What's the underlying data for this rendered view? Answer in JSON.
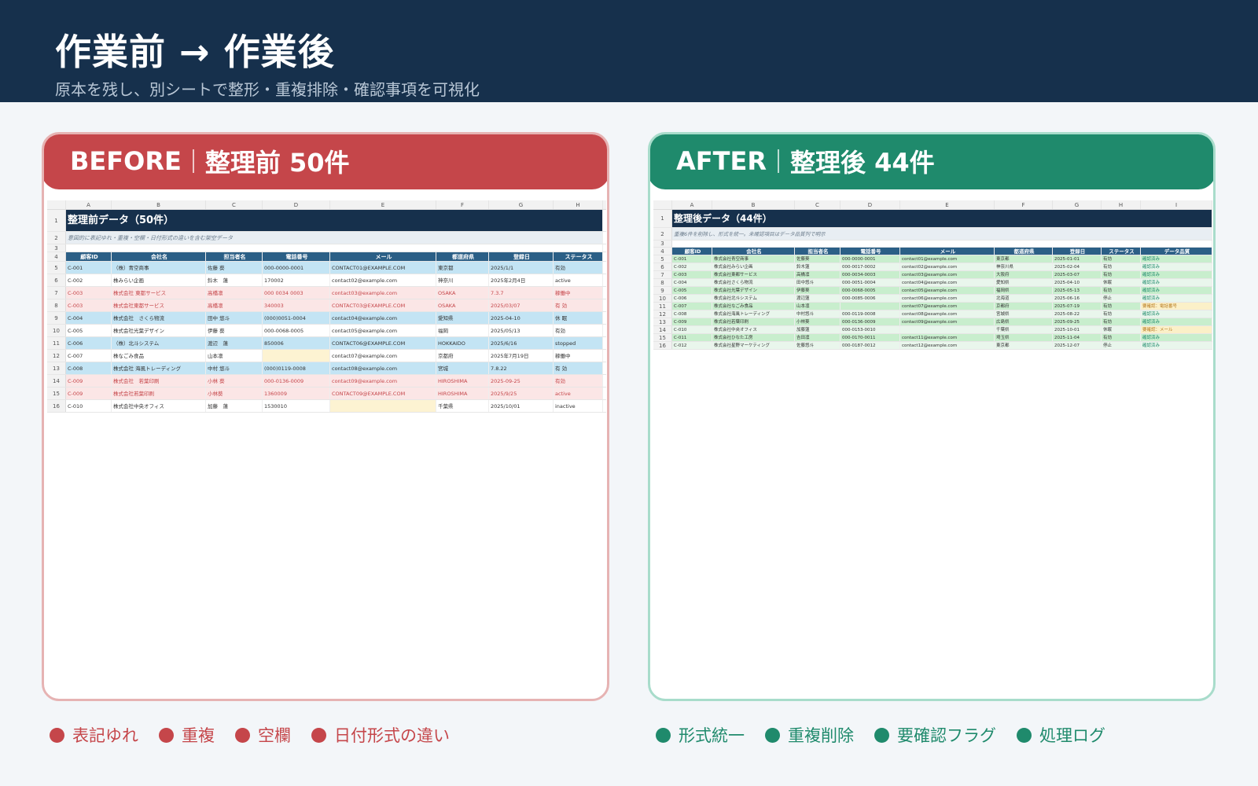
{
  "header": {
    "title": "作業前 → 作業後",
    "subtitle": "原本を残し、別シートで整形・重複排除・確認事項を可視化"
  },
  "before": {
    "label": "BEFORE",
    "count_label": "整理前 50件",
    "sheet": {
      "columns": [
        "A",
        "B",
        "C",
        "D",
        "E",
        "F",
        "G",
        "H"
      ],
      "title": "整理前データ（50件）",
      "note": "意図的に表記ゆれ・重複・空欄・日付形式の違いを含む架空データ",
      "headers": [
        "顧客ID",
        "会社名",
        "担当者名",
        "電話番号",
        "メール",
        "都道府県",
        "登録日",
        "ステータス"
      ],
      "rows": [
        {
          "n": "5",
          "style": "blue",
          "cells": [
            "C-001",
            "（株）青空商事",
            "佐藤 葵",
            "000-0000-0001",
            "CONTACT01@EXAMPLE.COM",
            "東京都",
            "2025/1/1",
            "有効"
          ]
        },
        {
          "n": "6",
          "style": "white",
          "cells": [
            "C-002",
            "株みらい企画",
            "鈴木　蓮",
            "170002",
            "contact02@example.com",
            "神奈川",
            "2025年2月4日",
            "active"
          ]
        },
        {
          "n": "7",
          "style": "pink",
          "cells": [
            "C-003",
            "株式会社 東都サービス",
            "高橋凛",
            "000 0034 0003",
            "contact03@example.com",
            "OSAKA",
            "7.3.7",
            "稼働中"
          ]
        },
        {
          "n": "8",
          "style": "pink",
          "cells": [
            "C-003",
            "株式会社東都サービス",
            "高橋凛",
            "340003",
            "CONTACT03@EXAMPLE.COM",
            "OSAKA",
            "2025/03/07",
            "有 効"
          ]
        },
        {
          "n": "9",
          "style": "blue",
          "cells": [
            "C-004",
            "株式会社　さくら物流",
            "田中 悠斗",
            "(000)0051-0004",
            "contact04@example.com",
            "愛知県",
            "2025-04-10",
            "休 眠"
          ]
        },
        {
          "n": "10",
          "style": "white",
          "cells": [
            "C-005",
            "株式会社光葉デザイン",
            "伊藤 葵",
            "000-0068-0005",
            "contact05@example.com",
            "福岡",
            "2025/05/13",
            "有効"
          ]
        },
        {
          "n": "11",
          "style": "blue",
          "cells": [
            "C-006",
            "（株）北斗システム",
            "渡辺　蓮",
            "850006",
            "CONTACT06@EXAMPLE.COM",
            "HOKKAIDO",
            "2025/6/16",
            "stopped"
          ]
        },
        {
          "n": "12",
          "style": "white",
          "cells": [
            "C-007",
            "株なごみ食品",
            "山本凛",
            "",
            "contact07@example.com",
            "京都府",
            "2025年7月19日",
            "稼働中"
          ]
        },
        {
          "n": "13",
          "style": "blue",
          "cells": [
            "C-008",
            "株式会社 海風トレーディング",
            "中村 悠斗",
            "(000)0119-0008",
            "contact08@example.com",
            "宮城",
            "7.8.22",
            "有 効"
          ]
        },
        {
          "n": "14",
          "style": "pink",
          "cells": [
            "C-009",
            "株式会社　若葉印刷",
            "小林 葵",
            "000-0136-0009",
            "contact09@example.com",
            "HIROSHIMA",
            "2025-09-25",
            "有効"
          ]
        },
        {
          "n": "15",
          "style": "pink",
          "cells": [
            "C-009",
            "株式会社若葉印刷",
            "小林葵",
            "1360009",
            "CONTACT09@EXAMPLE.COM",
            "HIROSHIMA",
            "2025/9/25",
            "active"
          ]
        },
        {
          "n": "16",
          "style": "white",
          "cells": [
            "C-010",
            "株式会社中央オフィス",
            "加藤　蓮",
            "1530010",
            "",
            "千葉県",
            "2025/10/01",
            "inactive"
          ]
        }
      ]
    }
  },
  "after": {
    "label": "AFTER",
    "count_label": "整理後 44件",
    "sheet": {
      "columns": [
        "A",
        "B",
        "C",
        "D",
        "E",
        "F",
        "G",
        "H",
        "I"
      ],
      "title": "整理後データ（44件）",
      "note": "重複6件を削除し、形式を統一。未確認項目はデータ品質列で明示",
      "headers": [
        "顧客ID",
        "会社名",
        "担当者名",
        "電話番号",
        "メール",
        "都道府県",
        "登録日",
        "ステータス",
        "データ品質"
      ],
      "rows": [
        {
          "n": "5",
          "style": "green",
          "cells": [
            "C-001",
            "株式会社青空商事",
            "佐藤葵",
            "000-0000-0001",
            "contact01@example.com",
            "東京都",
            "2025-01-01",
            "有効",
            "確認済み"
          ]
        },
        {
          "n": "6",
          "style": "lightgreen",
          "cells": [
            "C-002",
            "株式会社みらい企画",
            "鈴木蓮",
            "000-0017-0002",
            "contact02@example.com",
            "神奈川県",
            "2025-02-04",
            "有効",
            "確認済み"
          ]
        },
        {
          "n": "7",
          "style": "green",
          "cells": [
            "C-003",
            "株式会社東都サービス",
            "高橋凛",
            "000-0034-0003",
            "contact03@example.com",
            "大阪府",
            "2025-03-07",
            "有効",
            "確認済み"
          ]
        },
        {
          "n": "8",
          "style": "lightgreen",
          "cells": [
            "C-004",
            "株式会社さくら物流",
            "田中悠斗",
            "000-0051-0004",
            "contact04@example.com",
            "愛知県",
            "2025-04-10",
            "休眠",
            "確認済み"
          ]
        },
        {
          "n": "9",
          "style": "green",
          "cells": [
            "C-005",
            "株式会社光葉デザイン",
            "伊藤葵",
            "000-0068-0005",
            "contact05@example.com",
            "福岡県",
            "2025-05-13",
            "有効",
            "確認済み"
          ]
        },
        {
          "n": "10",
          "style": "lightgreen",
          "cells": [
            "C-006",
            "株式会社北斗システム",
            "渡辺蓮",
            "000-0085-0006",
            "contact06@example.com",
            "北海道",
            "2025-06-16",
            "停止",
            "確認済み"
          ]
        },
        {
          "n": "11",
          "style": "green",
          "cells": [
            "C-007",
            "株式会社なごみ食品",
            "山本凛",
            "",
            "contact07@example.com",
            "京都府",
            "2025-07-19",
            "有効",
            "要確認：電話番号"
          ]
        },
        {
          "n": "12",
          "style": "lightgreen",
          "cells": [
            "C-008",
            "株式会社海風トレーディング",
            "中村悠斗",
            "000-0119-0008",
            "contact08@example.com",
            "宮城県",
            "2025-08-22",
            "有効",
            "確認済み"
          ]
        },
        {
          "n": "13",
          "style": "green",
          "cells": [
            "C-009",
            "株式会社若葉印刷",
            "小林葵",
            "000-0136-0009",
            "contact09@example.com",
            "広島県",
            "2025-09-25",
            "有効",
            "確認済み"
          ]
        },
        {
          "n": "14",
          "style": "lightgreen",
          "cells": [
            "C-010",
            "株式会社中央オフィス",
            "加藤蓮",
            "000-0153-0010",
            "",
            "千葉県",
            "2025-10-01",
            "休眠",
            "要確認：メール"
          ]
        },
        {
          "n": "15",
          "style": "green",
          "cells": [
            "C-011",
            "株式会社ひなた工房",
            "吉田凛",
            "000-0170-0011",
            "contact11@example.com",
            "埼玉県",
            "2025-11-04",
            "有効",
            "確認済み"
          ]
        },
        {
          "n": "16",
          "style": "lightgreen",
          "cells": [
            "C-012",
            "株式会社星野マーケティング",
            "佐藤悠斗",
            "000-0187-0012",
            "contact12@example.com",
            "東京都",
            "2025-12-07",
            "停止",
            "確認済み"
          ]
        }
      ]
    }
  },
  "legend_before": [
    "表記ゆれ",
    "重複",
    "空欄",
    "日付形式の違い"
  ],
  "legend_after": [
    "形式統一",
    "重複削除",
    "要確認フラグ",
    "処理ログ"
  ],
  "colors": {
    "header_bg": "#16304c",
    "before_accent": "#c5464a",
    "after_accent": "#1f8a6c",
    "sheet_header_bg": "#2b5f86",
    "sheet_title_bg": "#16304c",
    "row_blue": "#c3e4f4",
    "row_pink": "#fbe6e6",
    "row_green": "#c8eecd",
    "row_lightgreen": "#e9f6ec",
    "flag_yellow": "#fbf0c8",
    "empty_cell": "#fdf3d2"
  }
}
